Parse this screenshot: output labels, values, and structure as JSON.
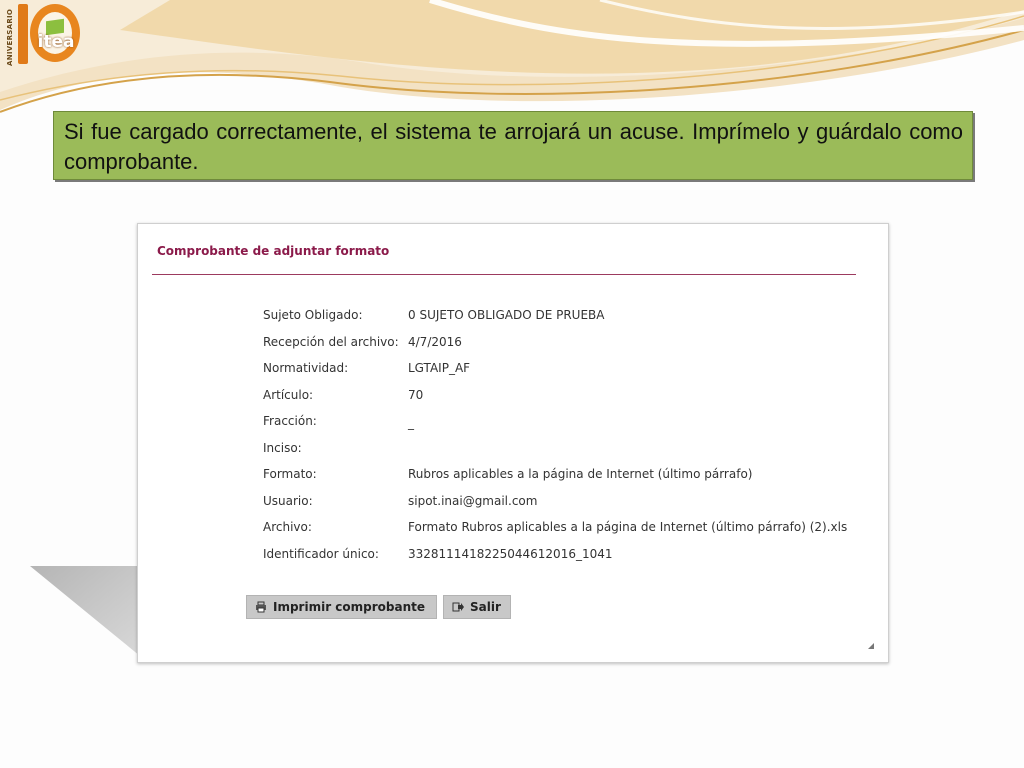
{
  "logo": {
    "text": "itea",
    "vertical_text": "ANIVERSARIO",
    "accent": "#e8861f",
    "brand_green": "#8cbf3f"
  },
  "instruction": {
    "text": "Si fue cargado correctamente, el sistema te arrojará un acuse. Imprímelo y guárdalo como comprobante.",
    "background": "#9bbb59"
  },
  "dialog": {
    "title": "Comprobante de adjuntar formato",
    "title_color": "#8b1a4a",
    "fields": [
      {
        "label": "Sujeto Obligado:",
        "value": "0 SUJETO OBLIGADO DE PRUEBA"
      },
      {
        "label": "Recepción del archivo:",
        "value": "4/7/2016"
      },
      {
        "label": "Normatividad:",
        "value": "LGTAIP_AF"
      },
      {
        "label": "Artículo:",
        "value": "70"
      },
      {
        "label": "Fracción:",
        "value": "_"
      },
      {
        "label": "Inciso:",
        "value": ""
      },
      {
        "label": "Formato:",
        "value": "Rubros aplicables a la página de Internet (último párrafo)"
      },
      {
        "label": "Usuario:",
        "value": "sipot.inai@gmail.com"
      },
      {
        "label": "Archivo:",
        "value": "Formato Rubros aplicables a la página de Internet (último párrafo) (2).xls"
      },
      {
        "label": "Identificador único:",
        "value": "332811141822504461​2016_1041"
      }
    ],
    "buttons": {
      "print": {
        "label": "Imprimir comprobante",
        "icon": "printer-icon"
      },
      "exit": {
        "label": "Salir",
        "icon": "exit-icon"
      }
    }
  }
}
